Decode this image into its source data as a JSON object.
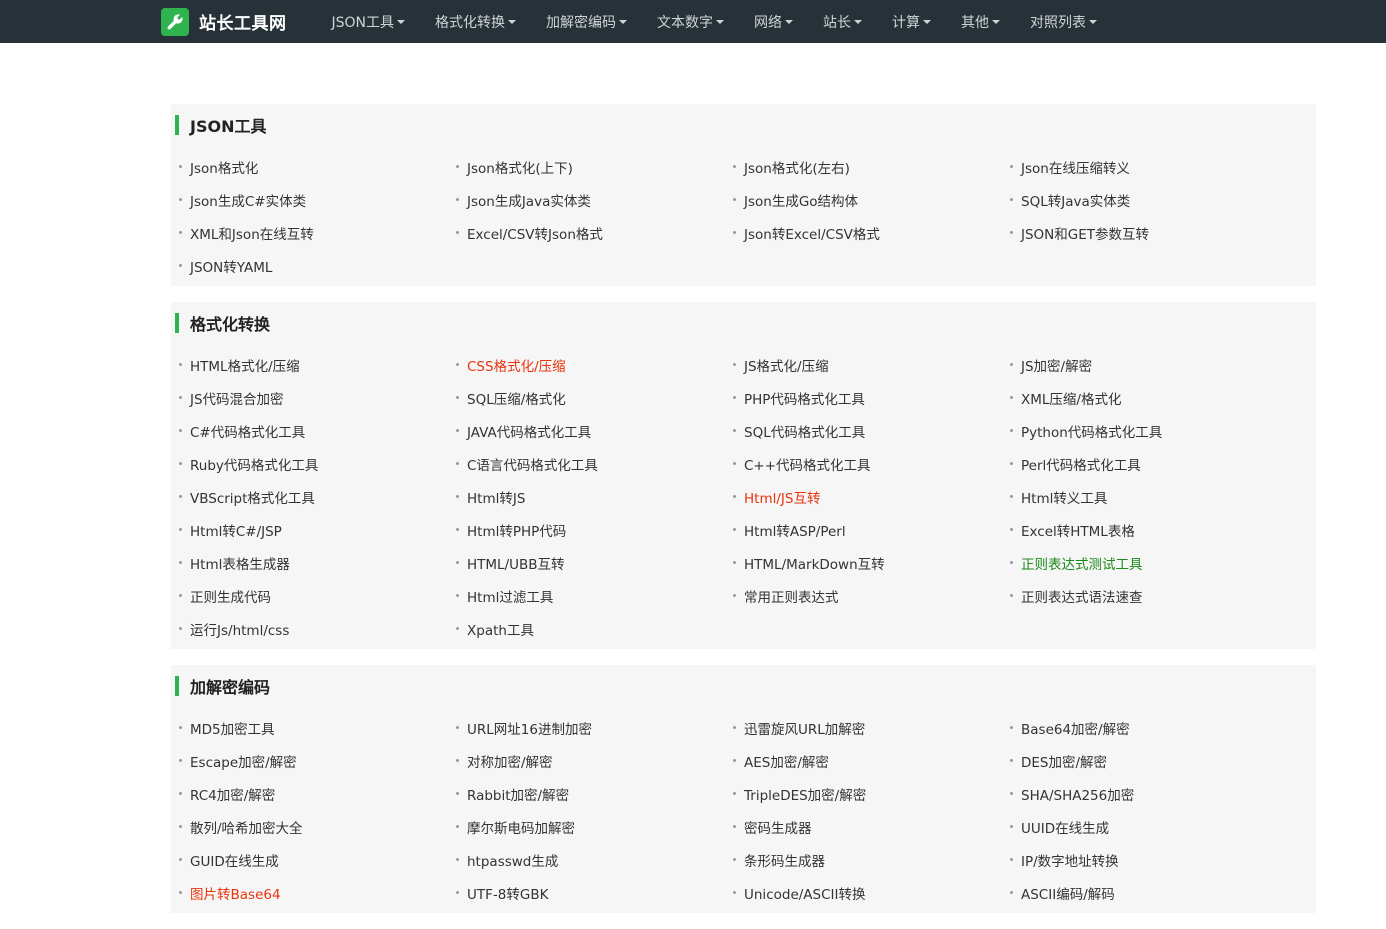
{
  "brand": {
    "name": "站长工具网",
    "logo_icon": "wrench-icon",
    "accent": "#2eb34f"
  },
  "nav": [
    {
      "label": "JSON工具"
    },
    {
      "label": "格式化转换"
    },
    {
      "label": "加解密编码"
    },
    {
      "label": "文本数字"
    },
    {
      "label": "网络"
    },
    {
      "label": "站长"
    },
    {
      "label": "计算"
    },
    {
      "label": "其他"
    },
    {
      "label": "对照列表"
    }
  ],
  "sections": [
    {
      "title": "JSON工具",
      "items": [
        {
          "label": "Json格式化"
        },
        {
          "label": "Json格式化(上下)"
        },
        {
          "label": "Json格式化(左右)"
        },
        {
          "label": "Json在线压缩转义"
        },
        {
          "label": "Json生成C#实体类"
        },
        {
          "label": "Json生成Java实体类"
        },
        {
          "label": "Json生成Go结构体"
        },
        {
          "label": "SQL转Java实体类"
        },
        {
          "label": "XML和Json在线互转"
        },
        {
          "label": "Excel/CSV转Json格式"
        },
        {
          "label": "Json转Excel/CSV格式"
        },
        {
          "label": "JSON和GET参数互转"
        },
        {
          "label": "JSON转YAML"
        }
      ]
    },
    {
      "title": "格式化转换",
      "items": [
        {
          "label": "HTML格式化/压缩"
        },
        {
          "label": "CSS格式化/压缩",
          "color": "red"
        },
        {
          "label": "JS格式化/压缩"
        },
        {
          "label": "JS加密/解密"
        },
        {
          "label": "JS代码混合加密"
        },
        {
          "label": "SQL压缩/格式化"
        },
        {
          "label": "PHP代码格式化工具"
        },
        {
          "label": "XML压缩/格式化"
        },
        {
          "label": "C#代码格式化工具"
        },
        {
          "label": "JAVA代码格式化工具"
        },
        {
          "label": "SQL代码格式化工具"
        },
        {
          "label": "Python代码格式化工具"
        },
        {
          "label": "Ruby代码格式化工具"
        },
        {
          "label": "C语言代码格式化工具"
        },
        {
          "label": "C++代码格式化工具"
        },
        {
          "label": "Perl代码格式化工具"
        },
        {
          "label": "VBScript格式化工具"
        },
        {
          "label": "Html转JS"
        },
        {
          "label": "Html/JS互转",
          "color": "red"
        },
        {
          "label": "Html转义工具"
        },
        {
          "label": "Html转C#/JSP"
        },
        {
          "label": "Html转PHP代码"
        },
        {
          "label": "Html转ASP/Perl"
        },
        {
          "label": "Excel转HTML表格"
        },
        {
          "label": "Html表格生成器"
        },
        {
          "label": "HTML/UBB互转"
        },
        {
          "label": "HTML/MarkDown互转"
        },
        {
          "label": "正则表达式测试工具",
          "color": "green"
        },
        {
          "label": "正则生成代码"
        },
        {
          "label": "Html过滤工具"
        },
        {
          "label": "常用正则表达式"
        },
        {
          "label": "正则表达式语法速查"
        },
        {
          "label": "运行Js/html/css"
        },
        {
          "label": "Xpath工具"
        }
      ]
    },
    {
      "title": "加解密编码",
      "items": [
        {
          "label": "MD5加密工具"
        },
        {
          "label": "URL网址16进制加密"
        },
        {
          "label": "迅雷旋风URL加解密"
        },
        {
          "label": "Base64加密/解密"
        },
        {
          "label": "Escape加密/解密"
        },
        {
          "label": "对称加密/解密"
        },
        {
          "label": "AES加密/解密"
        },
        {
          "label": "DES加密/解密"
        },
        {
          "label": "RC4加密/解密"
        },
        {
          "label": "Rabbit加密/解密"
        },
        {
          "label": "TripleDES加密/解密"
        },
        {
          "label": "SHA/SHA256加密"
        },
        {
          "label": "散列/哈希加密大全"
        },
        {
          "label": "摩尔斯电码加解密"
        },
        {
          "label": "密码生成器"
        },
        {
          "label": "UUID在线生成"
        },
        {
          "label": "GUID在线生成"
        },
        {
          "label": "htpasswd生成"
        },
        {
          "label": "条形码生成器"
        },
        {
          "label": "IP/数字地址转换"
        },
        {
          "label": "图片转Base64",
          "color": "red"
        },
        {
          "label": "UTF-8转GBK"
        },
        {
          "label": "Unicode/ASCII转换"
        },
        {
          "label": "ASCII编码/解码"
        }
      ]
    }
  ],
  "colors": {
    "nav_bg": "#263238",
    "section_bg": "#f6f6f6",
    "red": "#e8340e",
    "green": "#1a8a18"
  }
}
